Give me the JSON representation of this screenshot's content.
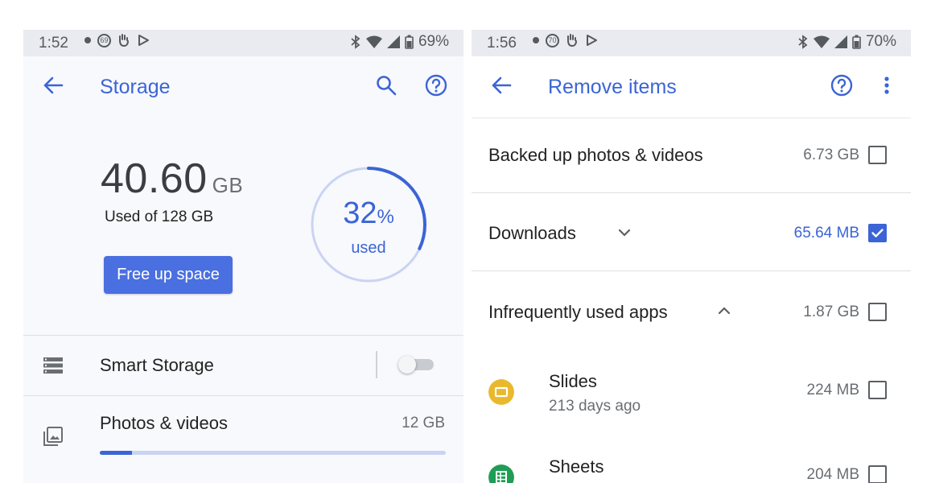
{
  "left": {
    "status": {
      "time": "1:52",
      "notif_count": "69",
      "battery": "69%"
    },
    "appbar": {
      "title": "Storage"
    },
    "storage": {
      "used_value": "40.60",
      "used_unit": "GB",
      "used_of": "Used of 128 GB",
      "free_button": "Free up space",
      "percent": "32",
      "percent_sign": "%",
      "percent_label": "used",
      "ring_fraction": 0.32
    },
    "rows": {
      "smart_storage": {
        "label": "Smart Storage",
        "enabled": false
      },
      "photos": {
        "label": "Photos & videos",
        "size": "12 GB",
        "fraction": 0.094
      }
    }
  },
  "right": {
    "status": {
      "time": "1:56",
      "notif_count": "70",
      "battery": "70%"
    },
    "appbar": {
      "title": "Remove items"
    },
    "items": [
      {
        "label": "Backed up photos & videos",
        "size": "6.73 GB",
        "checked": false
      },
      {
        "label": "Downloads",
        "size": "65.64 MB",
        "checked": true,
        "expanded": false
      },
      {
        "label": "Infrequently used apps",
        "size": "1.87 GB",
        "checked": false,
        "expanded": true
      }
    ],
    "apps": [
      {
        "name": "Slides",
        "sub": "213 days ago",
        "size": "224 MB",
        "checked": false,
        "color": "#e9b82c"
      },
      {
        "name": "Sheets",
        "size": "204 MB",
        "checked": false,
        "color": "#1f9d55"
      }
    ]
  },
  "colors": {
    "accent": "#3b64d6",
    "button": "#4a6fe0"
  }
}
